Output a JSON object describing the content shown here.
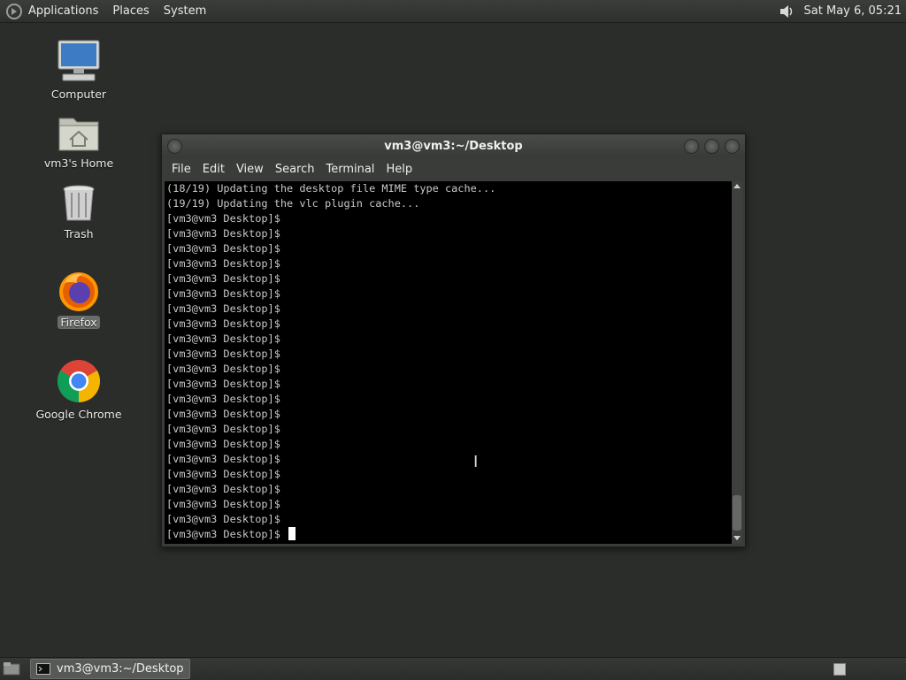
{
  "top_panel": {
    "menus": [
      "Applications",
      "Places",
      "System"
    ],
    "clock": "Sat May  6, 05:21",
    "volume_icon": "speaker-icon"
  },
  "desktop": {
    "icons": [
      {
        "label": "Computer",
        "icon": "computer-icon"
      },
      {
        "label": "vm3's Home",
        "icon": "home-folder-icon"
      },
      {
        "label": "Trash",
        "icon": "trash-icon"
      },
      {
        "label": "Firefox",
        "icon": "firefox-icon"
      },
      {
        "label": "Google Chrome",
        "icon": "chrome-icon"
      }
    ]
  },
  "terminal": {
    "title": "vm3@vm3:~/Desktop",
    "menus": [
      "File",
      "Edit",
      "View",
      "Search",
      "Terminal",
      "Help"
    ],
    "lines": [
      "(18/19) Updating the desktop file MIME type cache...",
      "(19/19) Updating the vlc plugin cache...",
      "[vm3@vm3 Desktop]$",
      "[vm3@vm3 Desktop]$",
      "[vm3@vm3 Desktop]$",
      "[vm3@vm3 Desktop]$",
      "[vm3@vm3 Desktop]$",
      "[vm3@vm3 Desktop]$",
      "[vm3@vm3 Desktop]$",
      "[vm3@vm3 Desktop]$",
      "[vm3@vm3 Desktop]$",
      "[vm3@vm3 Desktop]$",
      "[vm3@vm3 Desktop]$",
      "[vm3@vm3 Desktop]$",
      "[vm3@vm3 Desktop]$",
      "[vm3@vm3 Desktop]$",
      "[vm3@vm3 Desktop]$",
      "[vm3@vm3 Desktop]$",
      "[vm3@vm3 Desktop]$",
      "[vm3@vm3 Desktop]$",
      "[vm3@vm3 Desktop]$",
      "[vm3@vm3 Desktop]$",
      "[vm3@vm3 Desktop]$",
      "[vm3@vm3 Desktop]$"
    ]
  },
  "bottom_panel": {
    "task_label": "vm3@vm3:~/Desktop"
  }
}
